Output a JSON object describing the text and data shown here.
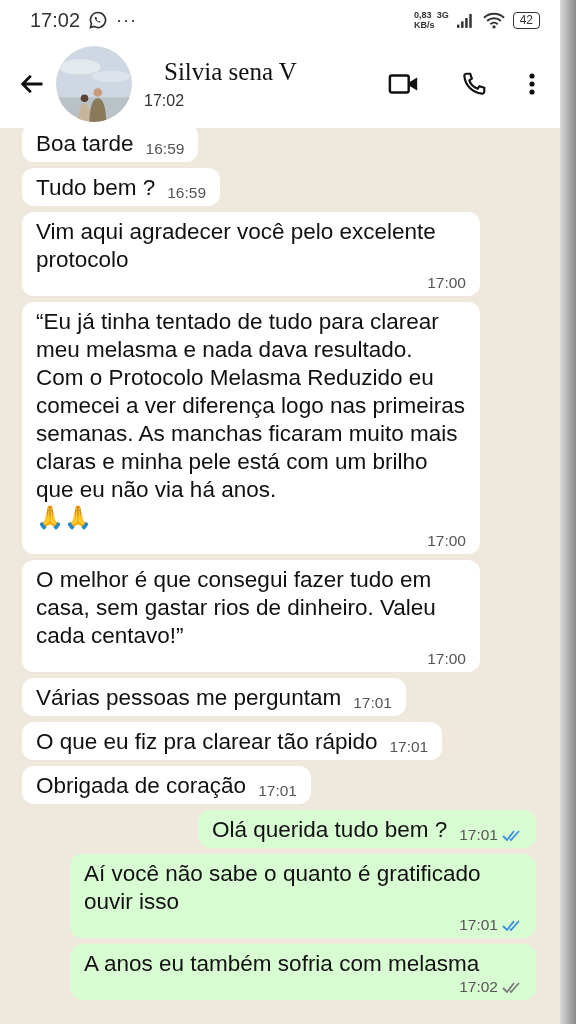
{
  "status_bar": {
    "time": "17:02",
    "more": "···",
    "speed_value": "0,83",
    "speed_unit": "KB/s",
    "network": "3G",
    "battery": "42"
  },
  "header": {
    "name": "Silvia sena V",
    "last_seen": "17:02"
  },
  "messages": [
    {
      "kind": "in",
      "text": "Boa tarde",
      "time": "16:59"
    },
    {
      "kind": "in",
      "text": "Tudo bem ?",
      "time": "16:59"
    },
    {
      "kind": "in",
      "text": "Vim aqui agradecer você pelo excelente protocolo",
      "time": "17:00"
    },
    {
      "kind": "in",
      "text": "“Eu já tinha tentado de tudo para clarear meu melasma e nada dava resultado. Com o Protocolo Melasma Reduzido eu comecei a ver diferença logo nas primeiras semanas. As manchas ficaram muito mais claras e minha pele está com um brilho que eu não via há anos.\n🙏🙏",
      "time": "17:00"
    },
    {
      "kind": "in",
      "text": "O melhor é que consegui fazer tudo em casa, sem gastar rios de dinheiro. Valeu cada centavo!”",
      "time": "17:00"
    },
    {
      "kind": "in",
      "text": "Várias pessoas me perguntam",
      "time": "17:01"
    },
    {
      "kind": "in",
      "text": "O que eu fiz pra clarear tão rápido",
      "time": "17:01"
    },
    {
      "kind": "in",
      "text": "Obrigada de coração",
      "time": "17:01"
    },
    {
      "kind": "out",
      "text": "Olá querida tudo bem ?",
      "time": "17:01",
      "read": true
    },
    {
      "kind": "out",
      "text": "Aí você não sabe o quanto é gratificado ouvir isso",
      "time": "17:01",
      "read": true
    },
    {
      "kind": "out",
      "text": "A anos eu também sofria com melasma",
      "time": "17:02",
      "read": false
    }
  ]
}
